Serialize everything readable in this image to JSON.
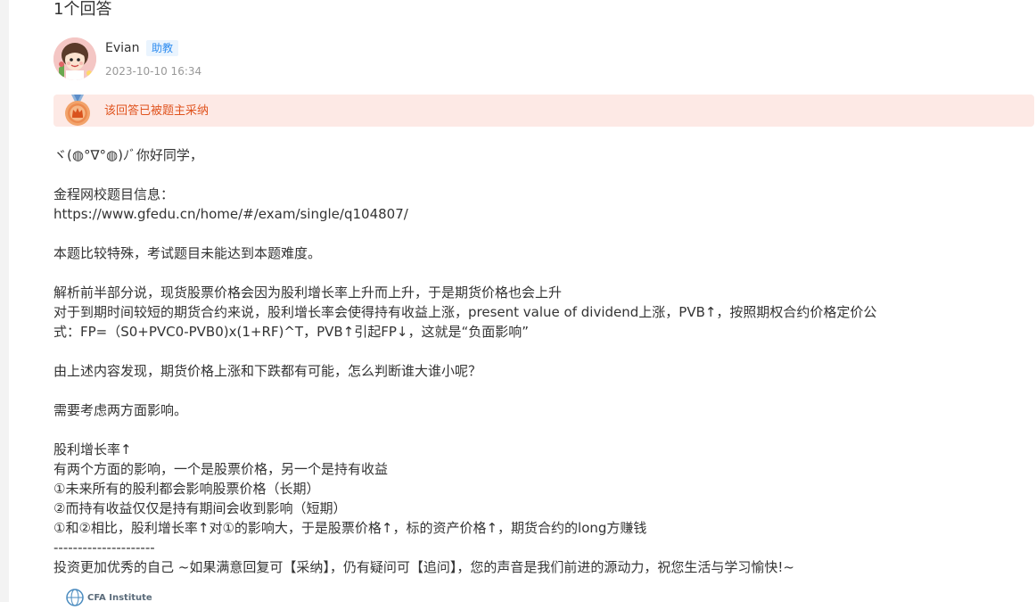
{
  "header": {
    "answer_count_label": "1个回答"
  },
  "author": {
    "name": "Evian",
    "role": "助教",
    "time": "2023-10-10 16:34"
  },
  "accepted": {
    "text": "该回答已被题主采纳"
  },
  "body": {
    "lines": [
      "ヾ(◍°∇°◍)ﾉﾞ你好同学，",
      "",
      "金程网校题目信息：",
      "https://www.gfedu.cn/home/#/exam/single/q104807/",
      "",
      "本题比较特殊，考试题目未能达到本题难度。",
      "",
      "解析前半部分说，现货股票价格会因为股利增长率上升而上升，于是期货价格也会上升",
      "对于到期时间较短的期货合约来说，股利增长率会使得持有收益上涨，present value of dividend上涨，PVB↑，按照期权合约价格定价公",
      "式：FP=（S0+PVC0-PVB0)x(1+RF)^T，PVB↑引起FP↓，这就是“负面影响”",
      "",
      "由上述内容发现，期货价格上涨和下跌都有可能，怎么判断谁大谁小呢？",
      "",
      "需要考虑两方面影响。",
      "",
      "股利增长率↑",
      "有两个方面的影响，一个是股票价格，另一个是持有收益",
      "①未来所有的股利都会影响股票价格（长期）",
      "②而持有收益仅仅是持有期间会收到影响（短期）",
      "①和②相比，股利增长率↑对①的影响大，于是股票价格↑，标的资产价格↑，期货合约的long方赚钱",
      "---------------------",
      "投资更加优秀的自己 ~如果满意回复可【采纳】，仍有疑问可【追问】，您的声音是我们前进的源动力，祝您生活与学习愉快!~"
    ]
  },
  "footer": {
    "logo_text": "CFA Institute"
  },
  "colors": {
    "accent_blue": "#2d8cf0",
    "accepted_bg": "#fde9e5",
    "accepted_text": "#e0541f"
  }
}
